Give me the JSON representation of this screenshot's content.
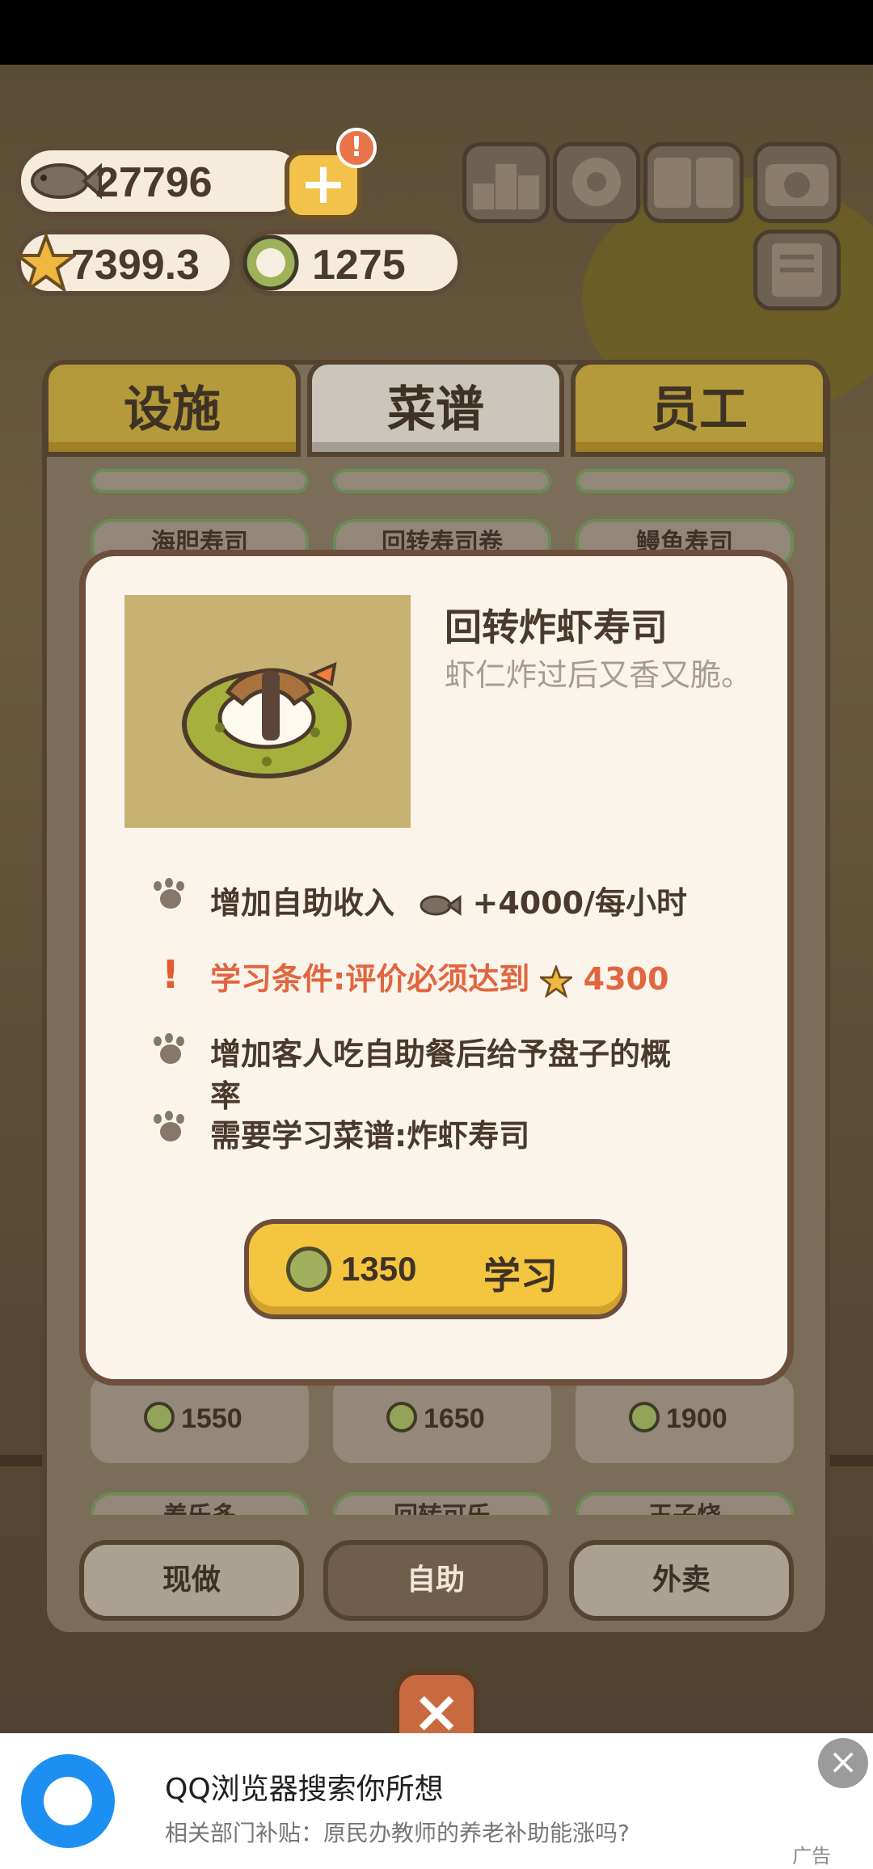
{
  "hud": {
    "fish_count": "27796",
    "star_rating": "7399.3",
    "coins": "1275",
    "plus_label": "+",
    "alert_label": "!"
  },
  "tabs": [
    {
      "label": "设施"
    },
    {
      "label": "菜谱"
    },
    {
      "label": "员工"
    }
  ],
  "menu_grid": {
    "visible_names": [
      "海胆寿司",
      "回转寿司卷",
      "鳗鱼寿司"
    ],
    "prices": [
      "1550",
      "1650",
      "1900"
    ],
    "bottom_row_names": [
      "养乐多",
      "回转可乐",
      "王子烧"
    ]
  },
  "bottom_buttons": [
    {
      "label": "现做"
    },
    {
      "label": "自助"
    },
    {
      "label": "外卖"
    }
  ],
  "recipe_modal": {
    "title": "回转炸虾寿司",
    "description": "虾仁炸过后又香又脆。",
    "benefit_income": "增加自助收入",
    "benefit_income_value": "+4000/每小时",
    "requirement_prefix": "学习条件:评价必须达到",
    "requirement_value": "4300",
    "benefit_plate": "增加客人吃自助餐后给予盘子的概率",
    "prerequisite": "需要学习菜谱:炸虾寿司",
    "learn_price": "1350",
    "learn_label": "学习"
  },
  "ad": {
    "title": "QQ浏览器搜索你所想",
    "subtitle": "相关部门补贴：原民办教师的养老补助能涨吗?",
    "tag": "广告",
    "close_label": "×"
  },
  "close_label": "×",
  "colors": {
    "tab_gold": "#b49a3a",
    "button_yellow": "#f4c53f",
    "requirement_red": "#e1653f",
    "text_brown": "#4a3a2d"
  },
  "icons": [
    "fish-icon",
    "star-icon",
    "coin-icon",
    "ranking-icon",
    "gear-icon",
    "recipe-book-icon",
    "camera-icon",
    "notes-icon",
    "paw-icon",
    "exclamation-icon"
  ]
}
